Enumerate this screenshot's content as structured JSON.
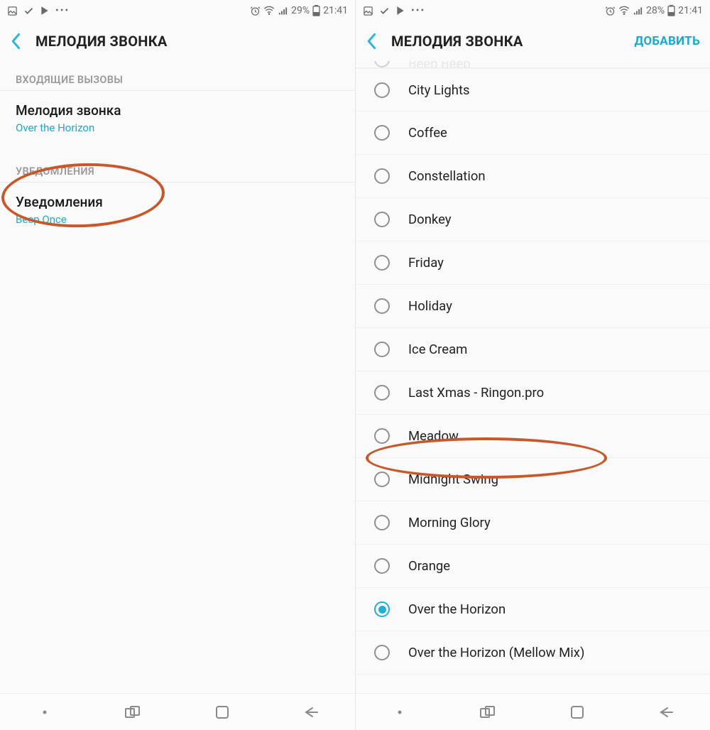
{
  "left": {
    "statusbar": {
      "battery": "29%",
      "time": "21:41"
    },
    "header": {
      "title": "МЕЛОДИЯ ЗВОНКА"
    },
    "section1": "ВХОДЯЩИЕ ВЫЗОВЫ",
    "row1": {
      "title": "Мелодия звонка",
      "sub": "Over the Horizon"
    },
    "section2": "УВЕДОМЛЕНИЯ",
    "row2": {
      "title": "Уведомления",
      "sub": "Beep Once"
    }
  },
  "right": {
    "statusbar": {
      "battery": "28%",
      "time": "21:41"
    },
    "header": {
      "title": "МЕЛОДИЯ ЗВОНКА",
      "action": "ДОБАВИТЬ"
    },
    "clipped_top_label": "Beep Beep",
    "ringtones": [
      {
        "label": "City Lights",
        "selected": false
      },
      {
        "label": "Coffee",
        "selected": false
      },
      {
        "label": "Constellation",
        "selected": false
      },
      {
        "label": "Donkey",
        "selected": false
      },
      {
        "label": "Friday",
        "selected": false
      },
      {
        "label": "Holiday",
        "selected": false
      },
      {
        "label": "Ice Cream",
        "selected": false
      },
      {
        "label": "Last Xmas - Ringon.pro",
        "selected": false
      },
      {
        "label": "Meadow",
        "selected": false
      },
      {
        "label": "Midnight Swing",
        "selected": false
      },
      {
        "label": "Morning Glory",
        "selected": false
      },
      {
        "label": "Orange",
        "selected": false
      },
      {
        "label": "Over the Horizon",
        "selected": true
      },
      {
        "label": "Over the Horizon (Mellow Mix)",
        "selected": false
      }
    ]
  },
  "colors": {
    "accent": "#1eb1d4",
    "highlight": "#c8572a"
  }
}
